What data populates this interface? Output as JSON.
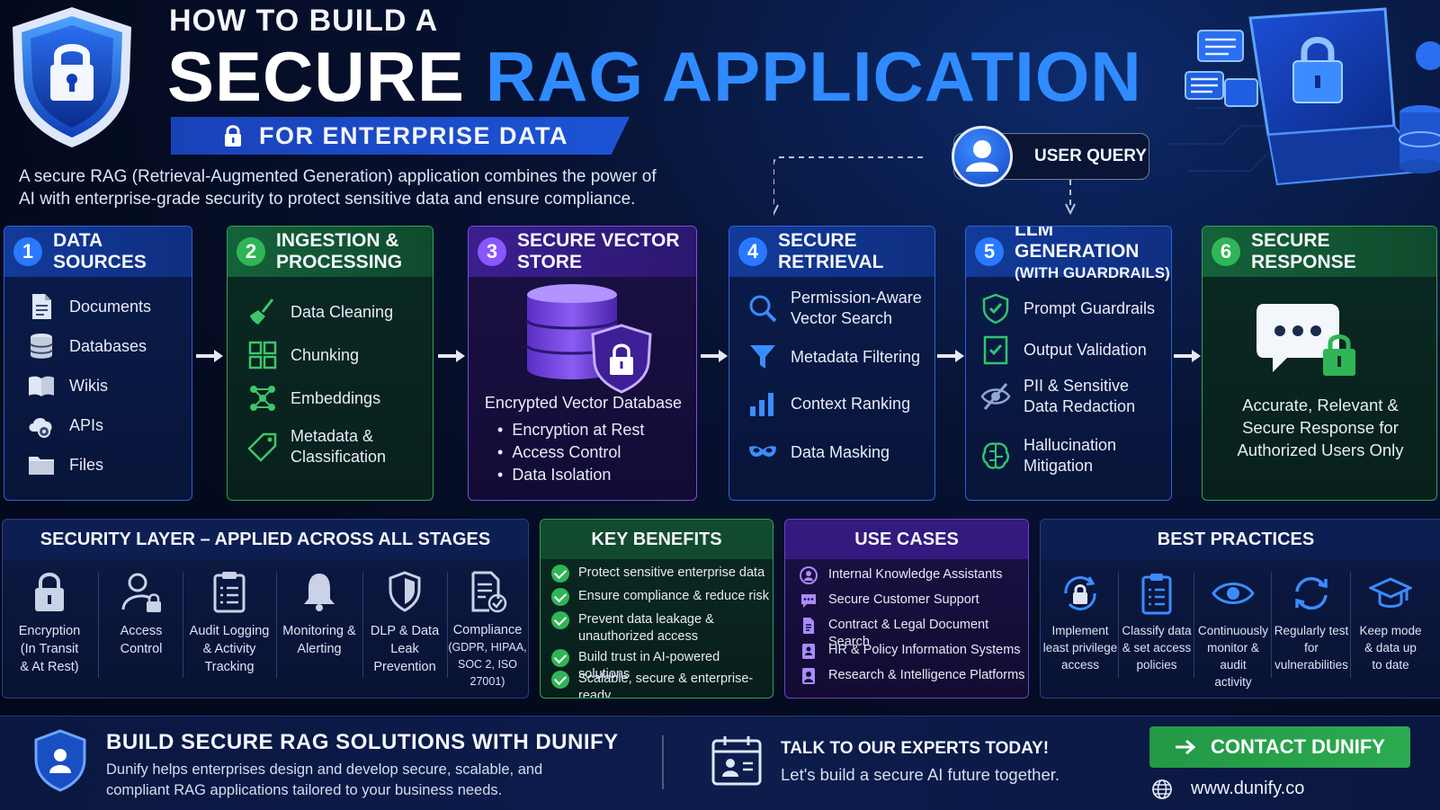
{
  "header": {
    "title_line1": "HOW TO BUILD A",
    "title_word1": "SECURE",
    "title_word2": "RAG APPLICATION",
    "subtitle": "FOR ENTERPRISE DATA",
    "intro": "A secure RAG (Retrieval-Augmented Generation) application combines the power of AI with enterprise-grade security to protect sensitive data and ensure compliance."
  },
  "user_query": {
    "label": "USER QUERY"
  },
  "stages": [
    {
      "num": "1",
      "title": "DATA SOURCES",
      "items": [
        {
          "label": "Documents",
          "icon": "document-icon"
        },
        {
          "label": "Databases",
          "icon": "database-icon"
        },
        {
          "label": "Wikis",
          "icon": "book-icon"
        },
        {
          "label": "APIs",
          "icon": "cloud-gear-icon"
        },
        {
          "label": "Files",
          "icon": "folder-icon"
        }
      ]
    },
    {
      "num": "2",
      "title": "INGESTION &",
      "title2": "PROCESSING",
      "items": [
        {
          "label": "Data Cleaning",
          "icon": "broom-icon"
        },
        {
          "label": "Chunking",
          "icon": "grid-icon"
        },
        {
          "label": "Embeddings",
          "icon": "network-icon"
        },
        {
          "label": "Metadata &",
          "label2": "Classification",
          "icon": "tag-icon"
        }
      ]
    },
    {
      "num": "3",
      "title": "SECURE VECTOR STORE",
      "db_label": "Encrypted Vector Database",
      "bullets": [
        "Encryption at Rest",
        "Access Control",
        "Data Isolation"
      ]
    },
    {
      "num": "4",
      "title": "SECURE RETRIEVAL",
      "items": [
        {
          "label": "Permission-Aware",
          "label2": "Vector Search",
          "icon": "search-icon"
        },
        {
          "label": "Metadata Filtering",
          "icon": "filter-icon"
        },
        {
          "label": "Context Ranking",
          "icon": "bar-chart-icon"
        },
        {
          "label": "Data Masking",
          "icon": "mask-icon"
        }
      ]
    },
    {
      "num": "5",
      "title": "LLM GENERATION",
      "title2": "(WITH GUARDRAILS)",
      "items": [
        {
          "label": "Prompt Guardrails",
          "icon": "shield-check-icon"
        },
        {
          "label": "Output Validation",
          "icon": "checklist-icon"
        },
        {
          "label": "PII & Sensitive",
          "label2": "Data Redaction",
          "icon": "eye-slash-icon"
        },
        {
          "label": "Hallucination",
          "label2": "Mitigation",
          "icon": "brain-icon"
        }
      ]
    },
    {
      "num": "6",
      "title": "SECURE RESPONSE",
      "lines": [
        "Accurate, Relevant &",
        "Secure Response for",
        "Authorized Users Only"
      ]
    }
  ],
  "security_layer": {
    "title": "SECURITY LAYER – APPLIED ACROSS ALL STAGES",
    "items": [
      {
        "lines": [
          "Encryption",
          "(In Transit",
          "& At Rest)"
        ],
        "icon": "padlock-icon"
      },
      {
        "lines": [
          "Access",
          "Control"
        ],
        "icon": "user-lock-icon"
      },
      {
        "lines": [
          "Audit Logging",
          "& Activity",
          "Tracking"
        ],
        "icon": "clipboard-icon"
      },
      {
        "lines": [
          "Monitoring &",
          "Alerting"
        ],
        "icon": "bell-icon"
      },
      {
        "lines": [
          "DLP & Data",
          "Leak Prevention"
        ],
        "icon": "shield-icon"
      },
      {
        "lines": [
          "Compliance",
          "(GDPR, HIPAA,",
          "SOC 2, ISO 27001)"
        ],
        "icon": "doc-check-icon"
      }
    ]
  },
  "key_benefits": {
    "title": "KEY BENEFITS",
    "items": [
      [
        "Protect sensitive enterprise data"
      ],
      [
        "Ensure compliance & reduce risk"
      ],
      [
        "Prevent data leakage &",
        "unauthorized access"
      ],
      [
        "Build trust in AI-powered solutions"
      ],
      [
        "Scalable, secure & enterprise-ready"
      ]
    ]
  },
  "use_cases": {
    "title": "USE CASES",
    "items": [
      {
        "label": "Internal Knowledge Assistants",
        "icon": "person-icon"
      },
      {
        "label": "Secure Customer Support",
        "icon": "chat-icon"
      },
      {
        "label": "Contract & Legal Document Search",
        "icon": "document-icon"
      },
      {
        "label": "HR & Policy Information Systems",
        "icon": "id-badge-icon"
      },
      {
        "label": "Research & Intelligence Platforms",
        "icon": "person-badge-icon"
      }
    ]
  },
  "best_practices": {
    "title": "BEST PRACTICES",
    "items": [
      {
        "lines": [
          "Implement",
          "least privilege",
          "access"
        ],
        "icon": "lock-cycle-icon"
      },
      {
        "lines": [
          "Classify data",
          "& set access",
          "policies"
        ],
        "icon": "clipboard-icon"
      },
      {
        "lines": [
          "Continuously",
          "monitor & audit",
          "activity"
        ],
        "icon": "eye-icon"
      },
      {
        "lines": [
          "Regularly test",
          "for vulnerabilities"
        ],
        "icon": "refresh-icon"
      },
      {
        "lines": [
          "Keep mode",
          "& data up",
          "to date"
        ],
        "icon": "graduation-cap-icon"
      }
    ]
  },
  "footer": {
    "title": "BUILD SECURE RAG SOLUTIONS WITH DUNIFY",
    "desc": "Dunify helps enterprises design and develop secure, scalable, and compliant RAG applications tailored to your business needs.",
    "cta_title": "TALK TO OUR EXPERTS TODAY!",
    "cta_sub": "Let's build a secure AI future together.",
    "button": "CONTACT DUNIFY",
    "website": "www.dunify.co"
  },
  "colors": {
    "blue": "#2879ff",
    "green": "#2fb556",
    "purple": "#8956ff",
    "title_blue": "#2f8bff"
  }
}
